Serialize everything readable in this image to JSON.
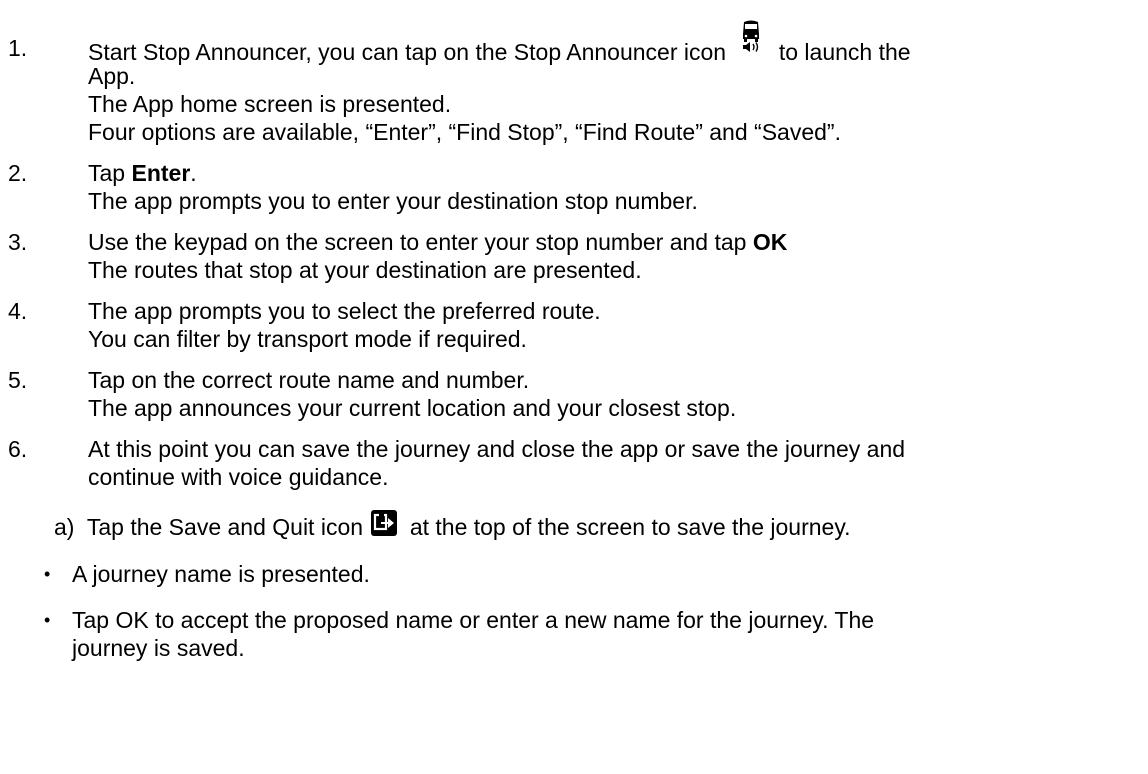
{
  "steps": [
    {
      "number": "1.",
      "lines": [
        {
          "before": "Start Stop Announcer, you can tap on the Stop Announcer icon",
          "after": "to launch the"
        },
        "App.",
        "The App home screen is presented.",
        "Four options are available, “Enter”, “Find Stop”, “Find Route” and “Saved”."
      ],
      "icon": "bus-speaker-icon"
    },
    {
      "number": "2.",
      "line1_prefix": "Tap ",
      "line1_bold": "Enter",
      "line1_suffix": ".",
      "line2": "The app prompts you to enter your destination stop number."
    },
    {
      "number": "3.",
      "line1_prefix": "Use the keypad on the screen to enter your stop number and tap ",
      "line1_bold": "OK",
      "line2": "The routes that stop at your destination are presented."
    },
    {
      "number": "4.",
      "line1": "The app prompts you to select the preferred route.",
      "line2": "You can filter by transport mode if required."
    },
    {
      "number": "5.",
      "line1": "Tap on the correct route name and number.",
      "line2": "The app announces your current location and your closest stop."
    },
    {
      "number": "6.",
      "line1": "At this point you can save the journey and close the app or save the journey and",
      "line2": "continue with voice guidance."
    }
  ],
  "substep": {
    "label": "a)",
    "before": "Tap the Save and Quit icon",
    "after": "at the top of the screen to save the journey.",
    "icon": "save-quit-icon"
  },
  "bullets": [
    {
      "symbol": "•",
      "line1": "A journey name is presented."
    },
    {
      "symbol": "•",
      "line1": "Tap OK to accept the proposed name or enter a new name for the journey. The",
      "line2": "journey is saved."
    }
  ]
}
